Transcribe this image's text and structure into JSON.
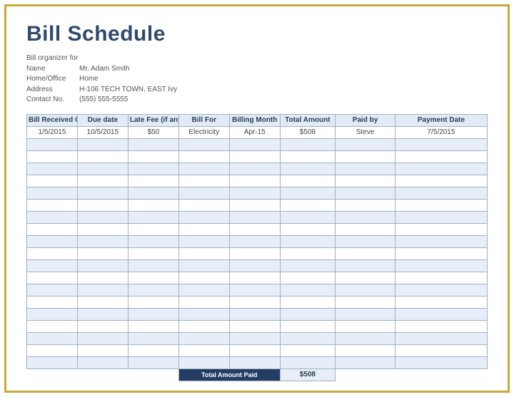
{
  "title": "Bill Schedule",
  "info": {
    "organizer_label": "Bill organizer for",
    "name_label": "Name",
    "name_value": "Mr. Adam Smith",
    "homeoffice_label": "Home/Office",
    "homeoffice_value": "Home",
    "address_label": "Address",
    "address_value": "H-106 TECH TOWN, EAST Ivy",
    "contact_label": "Contact No.",
    "contact_value": "(555) 555-5555"
  },
  "headers": {
    "received": "Bill Received On",
    "due": "Due date",
    "latefee": "Late Fee (if any)",
    "billfor": "Bill For",
    "month": "Billing Month",
    "total": "Total Amount",
    "paidby": "Paid by",
    "paydate": "Payment Date"
  },
  "rows": [
    {
      "received": "1/5/2015",
      "due": "10/5/2015",
      "latefee": "$50",
      "billfor": "Electricity",
      "month": "Apr-15",
      "total": "$508",
      "paidby": "Steve",
      "paydate": "7/5/2015"
    }
  ],
  "total_label": "Total Amount Paid",
  "total_value": "$508"
}
